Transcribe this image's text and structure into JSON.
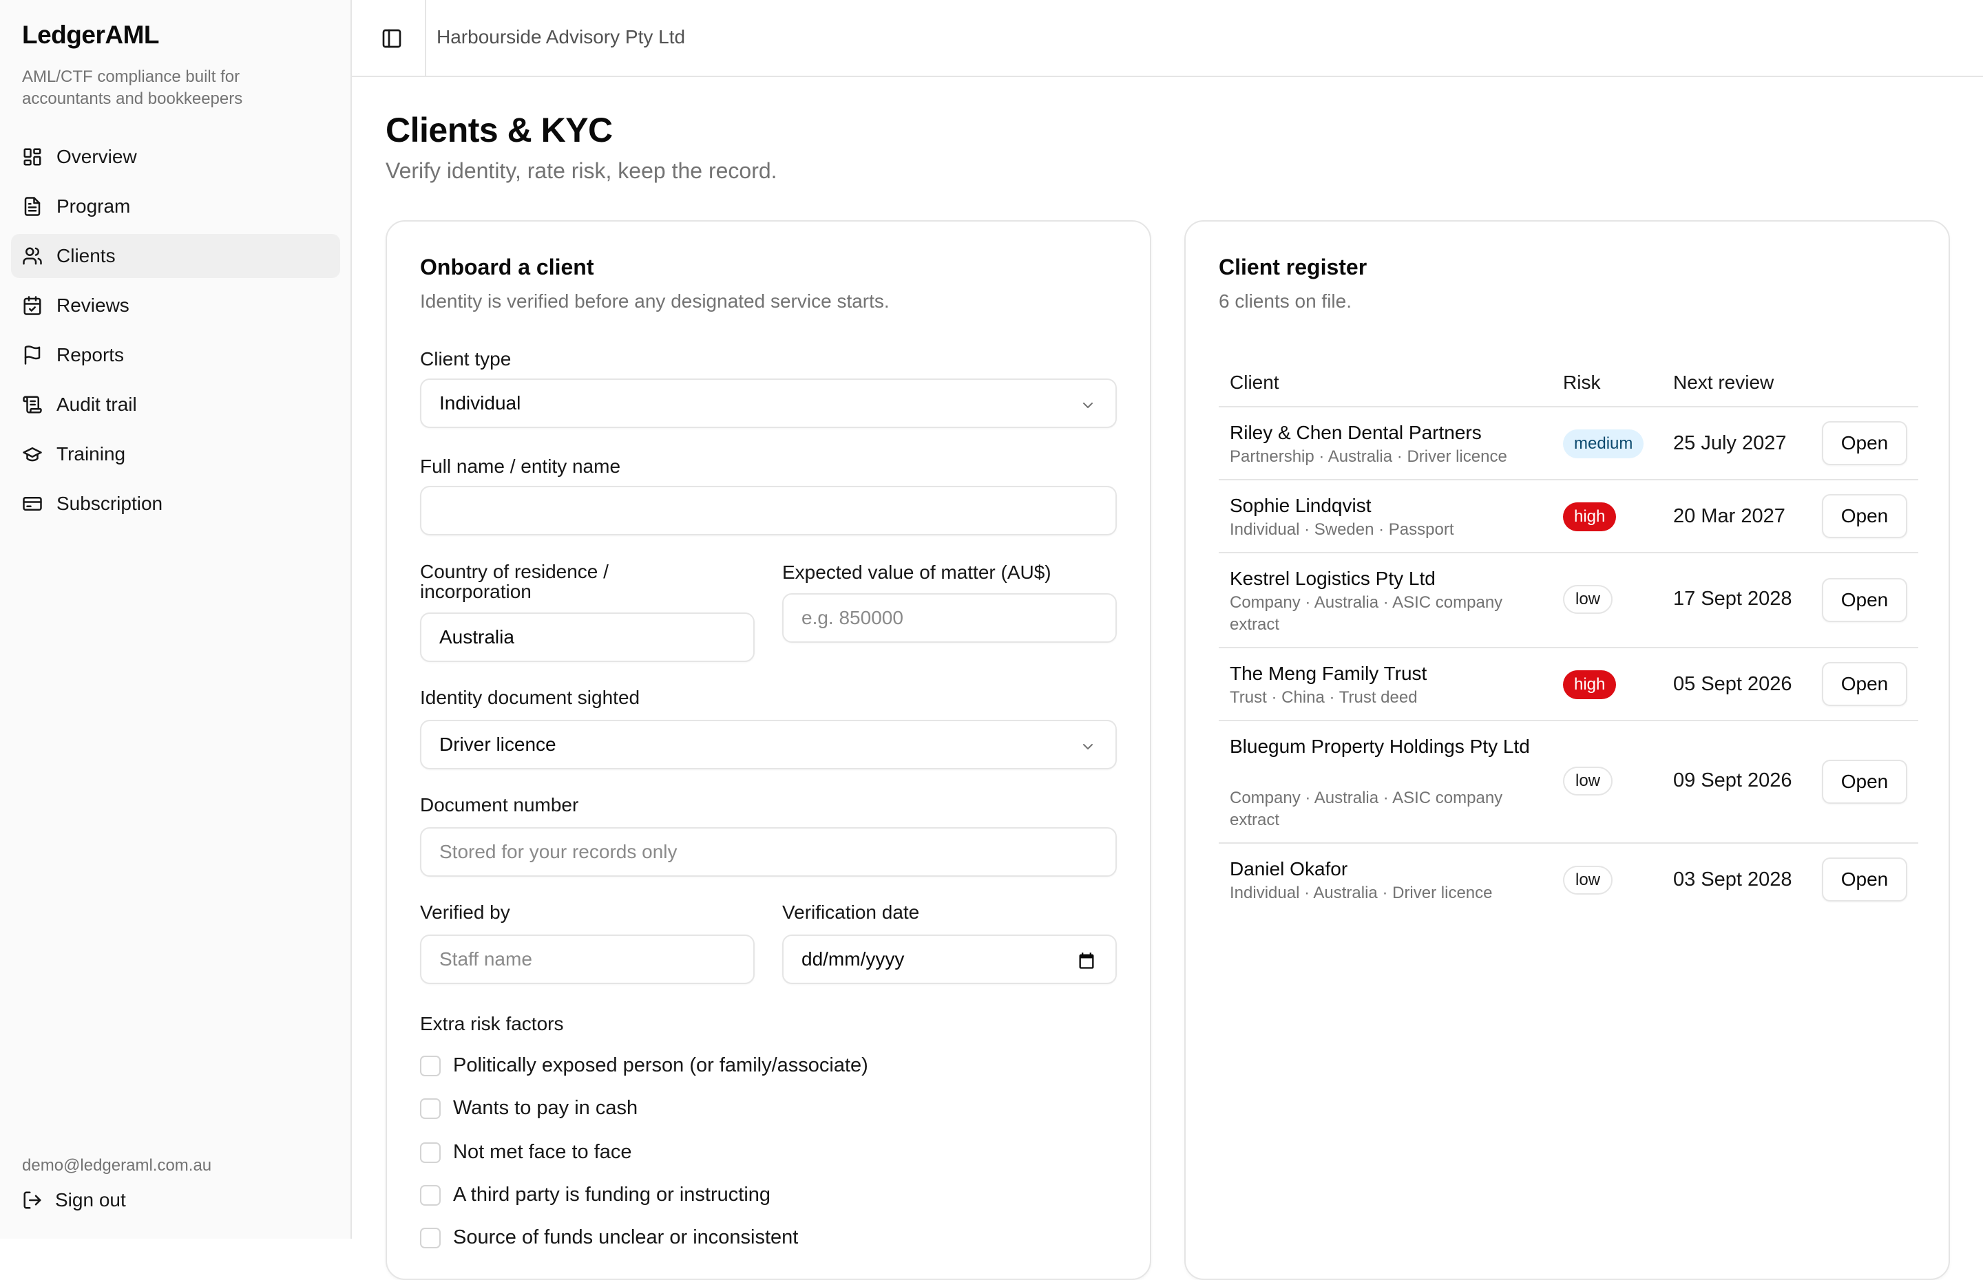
{
  "app": {
    "name": "LedgerAML",
    "tagline": "AML/CTF compliance built for accountants and bookkeepers",
    "organization": "Harbourside Advisory Pty Ltd"
  },
  "sidebar": {
    "items": [
      {
        "label": "Overview",
        "icon": "grid-icon"
      },
      {
        "label": "Program",
        "icon": "document-icon"
      },
      {
        "label": "Clients",
        "icon": "users-icon",
        "active": true
      },
      {
        "label": "Reviews",
        "icon": "calendar-check-icon"
      },
      {
        "label": "Reports",
        "icon": "flag-icon"
      },
      {
        "label": "Audit trail",
        "icon": "scroll-icon"
      },
      {
        "label": "Training",
        "icon": "graduation-cap-icon"
      },
      {
        "label": "Subscription",
        "icon": "credit-card-icon"
      }
    ],
    "user_email": "demo@ledgeraml.com.au",
    "signout_label": "Sign out"
  },
  "page": {
    "title": "Clients & KYC",
    "subtitle": "Verify identity, rate risk, keep the record."
  },
  "onboard": {
    "title": "Onboard a client",
    "subtitle": "Identity is verified before any designated service starts.",
    "client_type_label": "Client type",
    "client_type_value": "Individual",
    "full_name_label": "Full name / entity name",
    "full_name_value": "",
    "country_label": "Country of residence / incorporation",
    "country_value": "Australia",
    "expected_value_label": "Expected value of matter (AU$)",
    "expected_value_placeholder": "e.g. 850000",
    "id_doc_label": "Identity document sighted",
    "id_doc_value": "Driver licence",
    "doc_number_label": "Document number",
    "doc_number_placeholder": "Stored for your records only",
    "verified_by_label": "Verified by",
    "verified_by_placeholder": "Staff name",
    "verification_date_label": "Verification date",
    "verification_date_placeholder": "dd/mm/yyyy",
    "risk_factors_label": "Extra risk factors",
    "risk_factors": [
      "Politically exposed person (or family/associate)",
      "Wants to pay in cash",
      "Not met face to face",
      "A third party is funding or instructing",
      "Source of funds unclear or inconsistent"
    ]
  },
  "register": {
    "title": "Client register",
    "subtitle": "6 clients on file.",
    "columns": [
      "Client",
      "Risk",
      "Next review"
    ],
    "open_label": "Open",
    "rows": [
      {
        "name": "Riley & Chen Dental Partners",
        "meta": "Partnership · Australia · Driver licence",
        "risk": "medium",
        "next_review": "25 July 2027"
      },
      {
        "name": "Sophie Lindqvist",
        "meta": "Individual · Sweden · Passport",
        "risk": "high",
        "next_review": "20 Mar 2027"
      },
      {
        "name": "Kestrel Logistics Pty Ltd",
        "meta": "Company · Australia · ASIC company extract",
        "risk": "low",
        "next_review": "17 Sept 2028"
      },
      {
        "name": "The Meng Family Trust",
        "meta": "Trust · China · Trust deed",
        "risk": "high",
        "next_review": "05 Sept 2026"
      },
      {
        "name": "Bluegum Property Holdings Pty Ltd",
        "meta": "Company · Australia · ASIC company extract",
        "risk": "low",
        "next_review": "09 Sept 2026"
      },
      {
        "name": "Daniel Okafor",
        "meta": "Individual · Australia · Driver licence",
        "risk": "low",
        "next_review": "03 Sept 2028"
      }
    ]
  },
  "colors": {
    "risk_high": "#dc0d14",
    "risk_medium_bg": "#e0f2fe",
    "border": "#e5e5e5",
    "muted_text": "#737373"
  }
}
